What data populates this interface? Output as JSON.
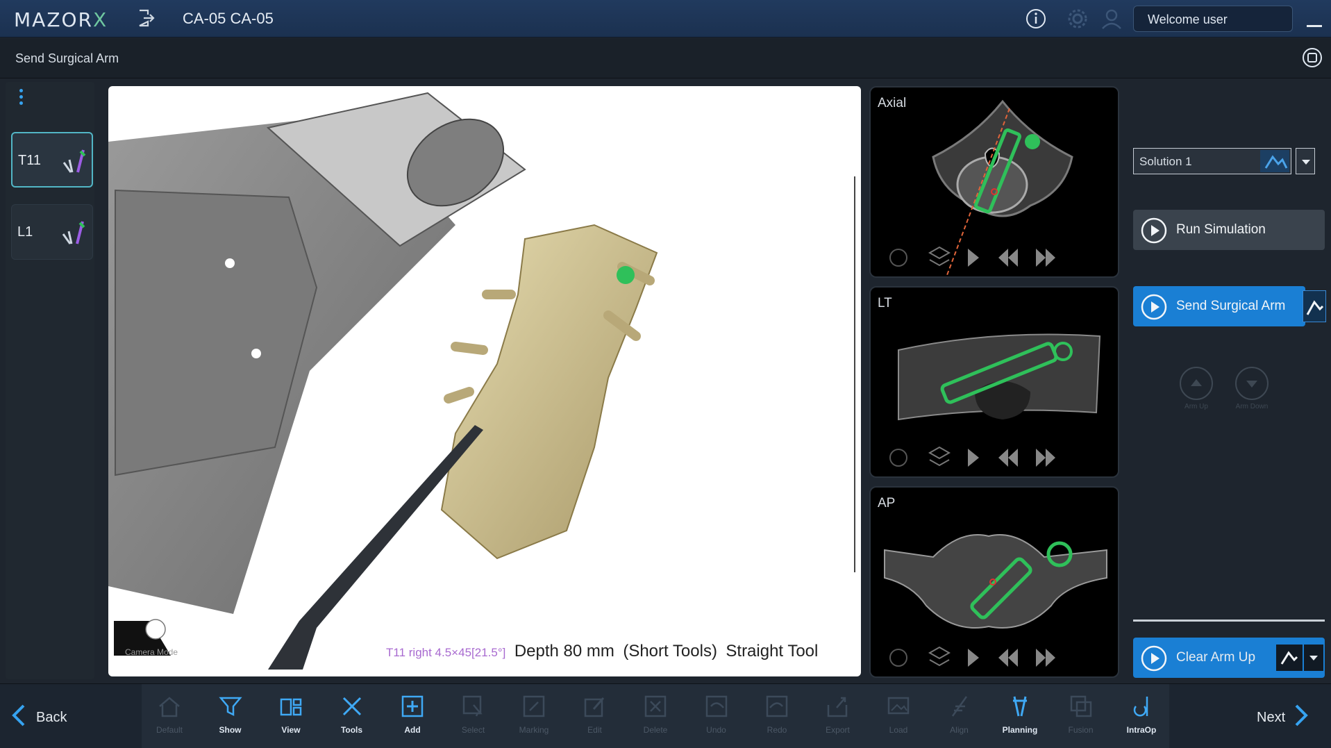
{
  "header": {
    "logo_main": "MAZOR",
    "logo_x": "X",
    "case_title": "CA-05 CA-05",
    "welcome": "Welcome user"
  },
  "subheader": {
    "title": "Send Surgical Arm"
  },
  "levels": [
    {
      "label": "T11",
      "active": true
    },
    {
      "label": "L1",
      "active": false
    }
  ],
  "view3d": {
    "screw_info": "T11 right  4.5×45[21.5°]",
    "depth": "Depth 80 mm",
    "tools": "(Short Tools)",
    "tool_type": "Straight Tool",
    "camera_mode": "Camera Mode"
  },
  "scans": [
    {
      "label": "Axial"
    },
    {
      "label": "LT"
    },
    {
      "label": "AP"
    }
  ],
  "right_panel": {
    "solution": "Solution 1",
    "run_simulation": "Run Simulation",
    "send_surgical_arm": "Send Surgical Arm",
    "arm_up": "Arm Up",
    "arm_down": "Arm Down",
    "clear_arm_up": "Clear Arm Up"
  },
  "footer": {
    "back": "Back",
    "next": "Next",
    "tools": [
      {
        "label": "Default",
        "icon": "home-icon",
        "enabled": false
      },
      {
        "label": "Show",
        "icon": "funnel-icon",
        "enabled": true
      },
      {
        "label": "View",
        "icon": "view-icon",
        "enabled": true
      },
      {
        "label": "Tools",
        "icon": "tools-icon",
        "enabled": true
      },
      {
        "label": "Add",
        "icon": "add-icon",
        "enabled": true
      },
      {
        "label": "Select",
        "icon": "select-icon",
        "enabled": false
      },
      {
        "label": "Marking",
        "icon": "marking-icon",
        "enabled": false
      },
      {
        "label": "Edit",
        "icon": "edit-icon",
        "enabled": false
      },
      {
        "label": "Delete",
        "icon": "delete-icon",
        "enabled": false
      },
      {
        "label": "Undo",
        "icon": "undo-icon",
        "enabled": false
      },
      {
        "label": "Redo",
        "icon": "redo-icon",
        "enabled": false
      },
      {
        "label": "Export",
        "icon": "export-icon",
        "enabled": false
      },
      {
        "label": "Load",
        "icon": "load-icon",
        "enabled": false
      },
      {
        "label": "Align",
        "icon": "align-icon",
        "enabled": false
      },
      {
        "label": "Planning",
        "icon": "planning-icon",
        "enabled": true
      },
      {
        "label": "Fusion",
        "icon": "fusion-icon",
        "enabled": false
      },
      {
        "label": "IntraOp",
        "icon": "intraop-icon",
        "enabled": true
      }
    ]
  },
  "colors": {
    "accent_blue": "#1a7fd4",
    "screw_green": "#2fc05a",
    "header_blue": "#1b3150"
  }
}
